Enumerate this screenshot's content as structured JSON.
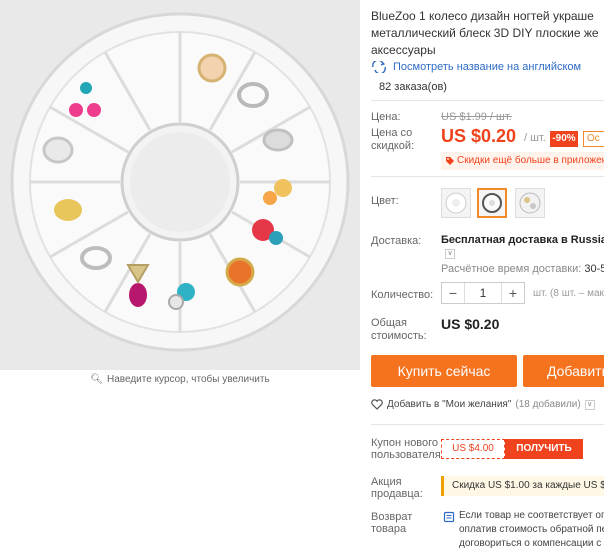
{
  "image": {
    "zoom_hint": "Наведите курсор, чтобы увеличить"
  },
  "product": {
    "title_lines": [
      "BlueZoo 1 колесо дизайн ногтей украше",
      "металлический блеск 3D DIY плоские же",
      "аксессуары"
    ],
    "translate_link": "Посмотреть название на английском",
    "orders": "82 заказа(ов)"
  },
  "price": {
    "label_price": "Цена:",
    "old_price": "US $1.99 / шт.",
    "label_discount_1": "Цена со",
    "label_discount_2": "скидкой:",
    "new_price": "US $0.20",
    "unit": "/ шт.",
    "discount_badge": "-90%",
    "other_tag": "Ос",
    "promo_text": "Скидки ещё больше в приложен"
  },
  "color": {
    "label": "Цвет:",
    "swatch_count": 3,
    "selected_index": 1
  },
  "shipping": {
    "label": "Доставка:",
    "value": "Бесплатная доставка в Russian Fe",
    "time_label": "Расчётное время доставки:",
    "time_value": "30-50"
  },
  "quantity": {
    "label": "Количество:",
    "value": "1",
    "minus": "−",
    "plus": "+",
    "note": "шт. (8 шт. – макс на"
  },
  "total": {
    "label_1": "Общая",
    "label_2": "стоимость:",
    "value": "US $0.20"
  },
  "actions": {
    "buy_now": "Купить сейчас",
    "add_to_cart": "Добавить",
    "wishlist": "Добавить в \"Мои желания\"",
    "wishlist_count": "(18 добавили)"
  },
  "coupon": {
    "label_1": "Купон нового",
    "label_2": "пользователя",
    "amount": "US $4.00",
    "get": "ПОЛУЧИТЬ"
  },
  "seller": {
    "label_1": "Акция",
    "label_2": "продавца:",
    "promo": "Скидка US $1.00 за каждые US $2"
  },
  "returns": {
    "label_1": "Возврат",
    "label_2": "товара",
    "lines": [
      "Если товар не соответствует оп",
      "оплатив стоимость обратной пе",
      "договориться о компенсации с"
    ]
  },
  "colors": {
    "accent": "#f0421c",
    "button": "#f5731f",
    "link": "#2e6bc6"
  }
}
